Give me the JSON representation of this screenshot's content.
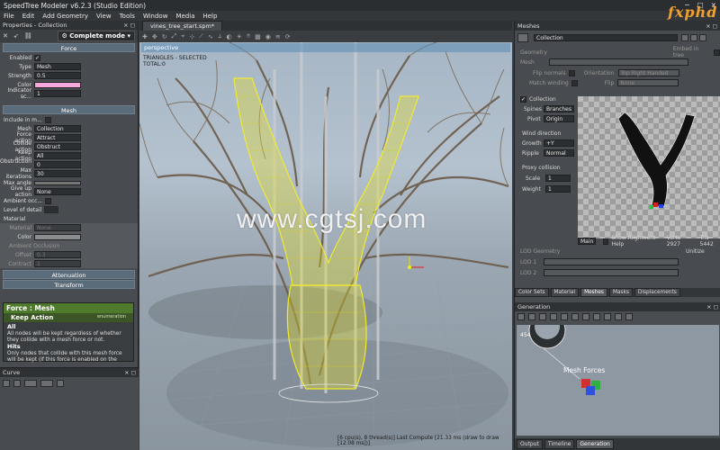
{
  "window": {
    "title": "SpeedTree Modeler v6.2.3 (Studio Edition)",
    "controls": [
      "−",
      "□",
      "×"
    ]
  },
  "menu": [
    "File",
    "Edit",
    "Add Geometry",
    "View",
    "Tools",
    "Window",
    "Media",
    "Help"
  ],
  "logo_text": "fxphd",
  "properties": {
    "header": "Properties - Collection",
    "mode": "Complete mode",
    "force_section": "Force",
    "enabled_label": "Enabled",
    "type_label": "Type",
    "type_value": "Mesh",
    "strength_label": "Strength",
    "strength_value": "0.5",
    "color_label": "Color",
    "color_hex": "#f5a8dc",
    "indicator_label": "Indicator sc...",
    "indicator_value": "1",
    "mesh_section": "Mesh",
    "include_label": "Include in m...",
    "mesh_label": "Mesh",
    "mesh_value": "Collection",
    "force_action_label": "Force action",
    "force_action_value": "Attract",
    "collide_action_label": "Collide action",
    "collide_action_value": "Obstruct",
    "keep_action_label": "Keep action",
    "keep_action_value": "All",
    "obstruction_label": "Obstruction ...",
    "obstruction_value": "0",
    "max_iter_label": "Max iterations",
    "max_iter_value": "30",
    "max_angle_label": "Max angle",
    "give_up_label": "Give up action",
    "give_up_value": "None",
    "ambient_label": "Ambient occ...",
    "lod_label": "Level of detail",
    "material_label": "Material",
    "mat_material_label": "Material",
    "mat_material_value": "None",
    "mat_color_label": "Color",
    "ambient_occlusion_label": "Ambient Occlusion",
    "offset_label": "Offset",
    "offset_value": "0.3",
    "contract_label": "Contract",
    "contract_value": "1",
    "attenuation": "Attenuation",
    "transform": "Transform"
  },
  "help": {
    "title": "Force : Mesh",
    "sub": "Keep Action",
    "enum": "enumeration",
    "all_title": "All",
    "all_text": "All nodes will be kept regardless of whether they collide with a mesh force or not.",
    "hits_title": "Hits",
    "hits_text": "Only nodes that collide with this mesh force will be kept (if this force is enabled on the"
  },
  "curve": {
    "header": "Curve"
  },
  "viewport": {
    "tab": "vines_tree_start.spm*",
    "label": "perspective",
    "stats_line1": "TRIANGLES - SELECTED",
    "stats_line2": "TOTAL:0",
    "watermark": "www.cgtsj.com",
    "status": "[6 cpu(s), 8 thread(s)]  Last Compute [21.33 ms (draw to draw [12.08 ms])]"
  },
  "meshes": {
    "header": "Meshes",
    "collection": "Collection",
    "geometry": "Geometry",
    "mesh_label": "Mesh",
    "embed_label": "Embed in tree",
    "flip_normals": "Flip normals",
    "orientation": "Orientation",
    "orientation_value": "Top Right Handed",
    "match_winding": "Match winding",
    "flip": "Flip",
    "flip_value": "None",
    "collection_check": "Collection",
    "spines_label": "Spines",
    "spines_value": "Branches",
    "pivot_label": "Pivot",
    "pivot_value": "Origin",
    "wind_label": "Wind direction",
    "growth_label": "Growth",
    "growth_value": "+Y",
    "ripple_label": "Ripple",
    "ripple_value": "Normal",
    "proxy_label": "Proxy collision",
    "scale_label": "Scale",
    "scale_value": "1",
    "weight_label": "Weight",
    "weight_value": "1",
    "preview_select": "Main",
    "alignment_help": "Show Alignment Help",
    "verts": "Verts 2927",
    "tris": "Tris 5442",
    "unitize": "Unitize",
    "lod_geometry": "LOD Geometry",
    "lod1": "LOD 1",
    "lod2": "LOD 2",
    "tabs": [
      "Color Sets",
      "Material",
      "Meshes",
      "Masks",
      "Displacements"
    ]
  },
  "generation": {
    "header": "Generation",
    "node_id": "454",
    "node_label": "Mesh Forces",
    "bottom_tabs": [
      "Output",
      "Timeline",
      "Generation"
    ]
  }
}
